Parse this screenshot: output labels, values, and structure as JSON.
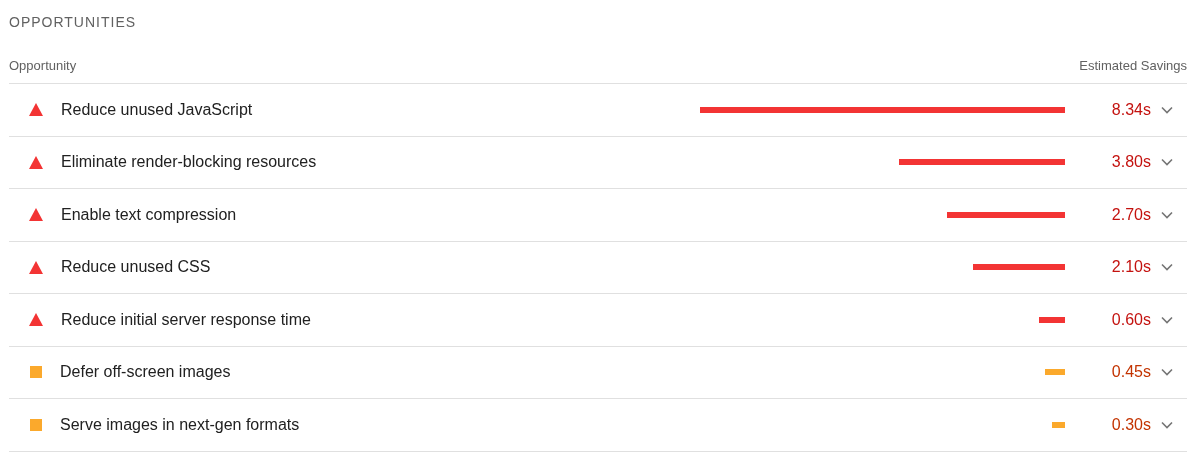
{
  "section_title": "OPPORTUNITIES",
  "columns": [
    "Opportunity",
    "Estimated Savings"
  ],
  "rows": [
    {
      "kind": "fail",
      "title": "Reduce unused JavaScript",
      "savings": "8.34s",
      "expanded": false
    },
    {
      "kind": "fail",
      "title": "Eliminate render-blocking resources",
      "savings": "3.80s",
      "expanded": false
    },
    {
      "kind": "fail",
      "title": "Enable text compression",
      "savings": "2.70s",
      "expanded": false
    },
    {
      "kind": "fail",
      "title": "Reduce unused CSS",
      "savings": "2.10s",
      "expanded": false
    },
    {
      "kind": "fail",
      "title": "Reduce initial server response time",
      "savings": "0.60s",
      "expanded": false
    },
    {
      "kind": "average",
      "title": "Defer off-screen images",
      "savings": "0.45s",
      "expanded": false
    },
    {
      "kind": "average",
      "title": "Serve images in next-gen formats",
      "savings": "0.30s",
      "expanded": false
    }
  ]
}
